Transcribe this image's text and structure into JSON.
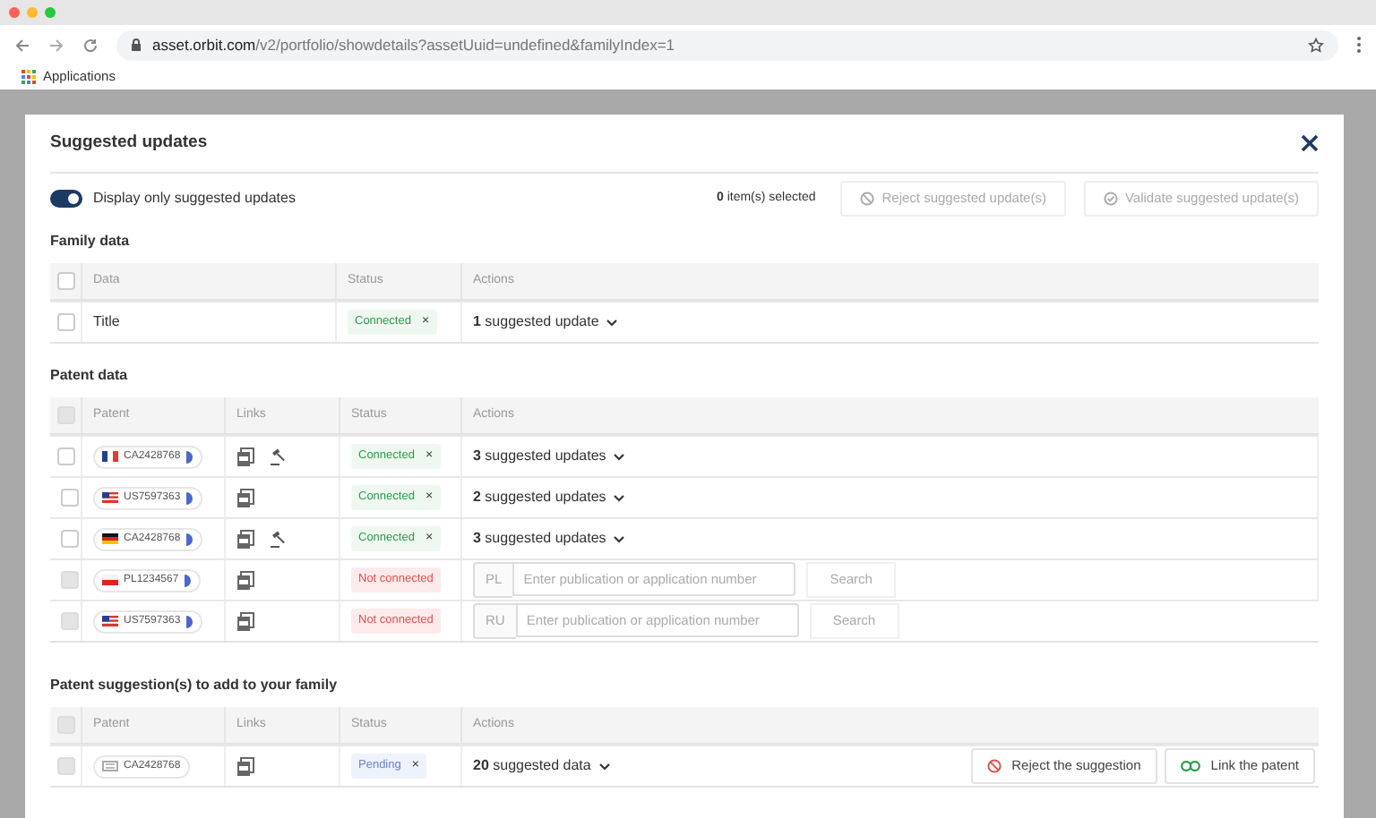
{
  "browser": {
    "url_host": "asset.orbit.com",
    "url_path": "/v2/portfolio/showdetails?assetUuid=undefined&familyIndex=1",
    "bookmarks": [
      "Applications"
    ]
  },
  "modal": {
    "title": "Suggested updates",
    "toggle": {
      "label": "Display only suggested updates",
      "on": true
    },
    "selected_count": "0",
    "selected_label": "item(s) selected",
    "buttons": [
      {
        "kind": "reject",
        "label": "Reject suggested update(s)",
        "disabled": true
      },
      {
        "kind": "validate",
        "label": "Validate suggested update(s)",
        "disabled": true
      }
    ]
  },
  "family_data": {
    "title": "Family data",
    "header_checkbox": {
      "checked": false,
      "disabled": false
    },
    "columns": [
      "Data",
      "Status",
      "Actions"
    ],
    "rows": [
      {
        "checked": false,
        "data": "Title",
        "status": {
          "label": "Connected",
          "kind": "connected",
          "remove": "×"
        },
        "action": "**1** suggested update"
      }
    ]
  },
  "patent_data": {
    "title": "Patent data",
    "header_checkbox": {
      "checked": false,
      "disabled": true
    },
    "columns": [
      "Patent",
      "Links",
      "Status",
      "Actions"
    ],
    "rows": [
      {
        "checked": false,
        "disabled": false,
        "flag": {
          "kind": "fr"
        },
        "patent": "CA2428768",
        "gavel": true,
        "status": {
          "label": "Connected",
          "kind": "connected",
          "remove": "×"
        },
        "kind": "updates",
        "action": "**3** suggested updates"
      },
      {
        "checked": false,
        "disabled": false,
        "flag": {
          "kind": "us"
        },
        "patent": "US7597363",
        "gavel": false,
        "status": {
          "label": "Connected",
          "kind": "connected",
          "remove": "×"
        },
        "kind": "updates",
        "action": "**2** suggested updates"
      },
      {
        "checked": false,
        "disabled": false,
        "flag": {
          "kind": "de"
        },
        "patent": "CA2428768",
        "gavel": true,
        "status": {
          "label": "Connected",
          "kind": "connected",
          "remove": "×"
        },
        "kind": "updates",
        "action": "**3** suggested updates"
      },
      {
        "checked": false,
        "disabled": true,
        "flag": {
          "kind": "pl"
        },
        "patent": "PL1234567",
        "gavel": false,
        "status": {
          "label": "Not connected",
          "kind": "not_connected"
        },
        "kind": "search",
        "prefix": "PL",
        "placeholder": "Enter publication or application number",
        "button": "Search"
      },
      {
        "checked": false,
        "disabled": true,
        "flag": {
          "kind": "us"
        },
        "patent": "US7597363",
        "gavel": false,
        "status": {
          "label": "Not connected",
          "kind": "not_connected"
        },
        "kind": "search",
        "prefix": "RU",
        "placeholder": "Enter publication or application number",
        "button": "Search"
      }
    ]
  },
  "suggestions": {
    "title": "Patent suggestion(s) to add to your family",
    "header_checkbox": {
      "checked": false,
      "disabled": true
    },
    "columns": [
      "Patent",
      "Links",
      "Status",
      "Actions"
    ],
    "rows": [
      {
        "checked": false,
        "disabled": true,
        "flag": {
          "kind": "doc"
        },
        "patent": "CA2428768",
        "gavel": false,
        "status": {
          "label": "Pending",
          "kind": "pending",
          "remove": "×"
        },
        "kind": "suggestion",
        "action": "**20** suggested data",
        "buttons": [
          "Reject the suggestion",
          "Link the patent"
        ]
      }
    ]
  }
}
